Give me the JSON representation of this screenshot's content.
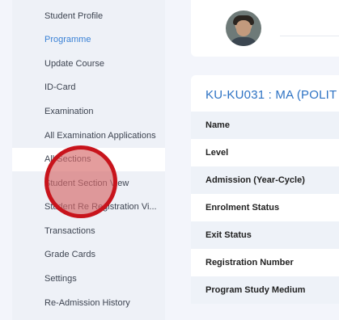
{
  "sidebar": {
    "items": [
      {
        "label": "Student Profile"
      },
      {
        "label": "Programme"
      },
      {
        "label": "Update Course"
      },
      {
        "label": "ID-Card"
      },
      {
        "label": "Examination"
      },
      {
        "label": "All Examination Applications"
      },
      {
        "label": "All Sections"
      },
      {
        "label": "Student Section View"
      },
      {
        "label": "Student Re Registration Vi..."
      },
      {
        "label": "Transactions"
      },
      {
        "label": "Grade Cards"
      },
      {
        "label": "Settings"
      },
      {
        "label": "Re-Admission History"
      }
    ],
    "active_item": "Programme",
    "highlighted_item": "All Sections"
  },
  "profile": {
    "avatar_icon": "user-photo"
  },
  "details": {
    "course_title": "KU-KU031 : MA (POLIT",
    "fields": [
      {
        "label": "Name"
      },
      {
        "label": "Level"
      },
      {
        "label": "Admission (Year-Cycle)"
      },
      {
        "label": "Enrolment Status"
      },
      {
        "label": "Exit Status"
      },
      {
        "label": "Registration Number"
      },
      {
        "label": "Program Study Medium"
      }
    ]
  },
  "colors": {
    "accent": "#3b82d6",
    "title": "#2e73c4",
    "cursor_ring": "#c8141c"
  }
}
